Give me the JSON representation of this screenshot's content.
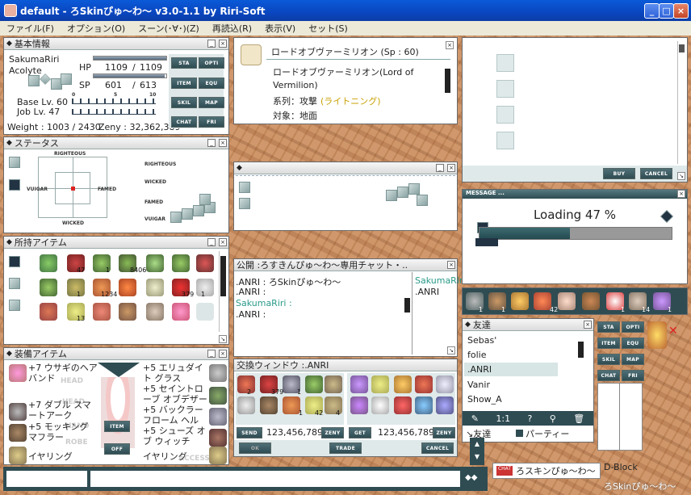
{
  "window": {
    "title": "default - ろSkinぴゅ～わ～ v3.0-1.1 by Riri-Soft",
    "min": "_",
    "max": "□",
    "close": "×"
  },
  "menu": [
    "ファイル(F)",
    "オプション(O)",
    "スーン(･∀･)(Z)",
    "再読込(R)",
    "表示(V)",
    "セット(S)"
  ],
  "basic": {
    "title": "基本情報",
    "name": "SakumaRiri",
    "job": "Acolyte",
    "hp_label": "HP",
    "hp_cur": "1109",
    "hp_sep": "/",
    "hp_max": "1109",
    "sp_label": "SP",
    "sp_cur": "601",
    "sp_sep": "/",
    "sp_max": "613",
    "hp_frac": 1.0,
    "sp_frac": 0.98,
    "base_lv": "Base Lv. 60",
    "job_lv": "Job Lv. 47",
    "weight": "Weight : 1003 / 2430",
    "zeny": "Zeny : 32,362,389",
    "scale": [
      "0",
      "5",
      "10"
    ],
    "buttons": [
      "STA",
      "OPTI",
      "ITEM",
      "EQU",
      "SKIL",
      "MAP",
      "CHAT",
      "FRI"
    ]
  },
  "status": {
    "title": "ステータス",
    "top": "RIGHTEOUS",
    "bottom": "WICKED",
    "left": "VUIGAR",
    "right": "FAMED",
    "list": [
      "RIGHTEOUS",
      "WICKED",
      "FAMED",
      "VUIGAR"
    ]
  },
  "inventory": {
    "title": "所持アイテム",
    "counts": [
      "47",
      "8406",
      "379",
      "1",
      "1",
      "1234",
      "1",
      "13"
    ]
  },
  "equip": {
    "title": "装備アイテム",
    "left": [
      "+7 ウサギのヘアバンド",
      "",
      "+7 ダブル スマートアーク",
      "+5 モッキング マフラー",
      "イヤリング"
    ],
    "right": [
      "+5 エリュダイト グラス",
      "+5 セイントローブ オブデザー",
      "+5 バックラー フローム ヘル",
      "+5 シューズ オブ ウィッチ",
      "イヤリング"
    ],
    "ghost": [
      "HEAD",
      "HEAD",
      "HAND",
      "ROBE",
      "ACCESS"
    ],
    "item_btn": "ITEM",
    "off_btn": "OFF"
  },
  "skill": {
    "title": "ロードオブヴァーミリオン (Sp : 60)",
    "desc1": "ロードオブヴァーミリオン(Lord of",
    "desc2": "Vermilion)",
    "kind_label": "系列：攻撃",
    "kind_value": "(ライトニング)",
    "target": "対象：地面"
  },
  "chat": {
    "title": "公開 :ろすきんぴゅ～わ～専用チャット・..",
    "lines": [
      ".ANRI : ろSkinぴゅ～わ～",
      ".ANRI :",
      "SakumaRiri :",
      ".ANRI :"
    ],
    "members": [
      "SakumaRiri",
      ".ANRI"
    ]
  },
  "trade": {
    "title": "交換ウィンドウ :.ANRI",
    "send": "SEND",
    "get": "GET",
    "zeny_left": "123,456,789",
    "zeny_right": "123,456,789",
    "zeny": "ZENY",
    "ok": "OK",
    "trade": "TRADE",
    "cancel": "CANCEL",
    "counts": [
      "2",
      "379",
      "1",
      "1",
      "42",
      "4"
    ]
  },
  "shop": {
    "buy": "BUY",
    "cancel": "CANCEL"
  },
  "loading": {
    "header": "MESSAGE ...",
    "text": "Loading 47 %",
    "progress": 0.47
  },
  "hotbar": {
    "counts": [
      "1",
      "1",
      "42",
      "1",
      "14",
      "1"
    ]
  },
  "friends": {
    "title": "友達",
    "list": [
      "Sebas'",
      "folie",
      ".ANRI",
      "Vanir",
      "Show_A"
    ],
    "tab_friend": "友達",
    "tab_party": "パーティー"
  },
  "mini": {
    "buttons": [
      "STA",
      "OPTI",
      "ITEM",
      "EQU",
      "SKIL",
      "MAP",
      "CHAT",
      "FRI"
    ]
  },
  "bottom": {
    "chatname": "ろスキンぴゅ～わ～",
    "block": "D-Block",
    "brand": "ろSkinぴゅ～わ～"
  }
}
